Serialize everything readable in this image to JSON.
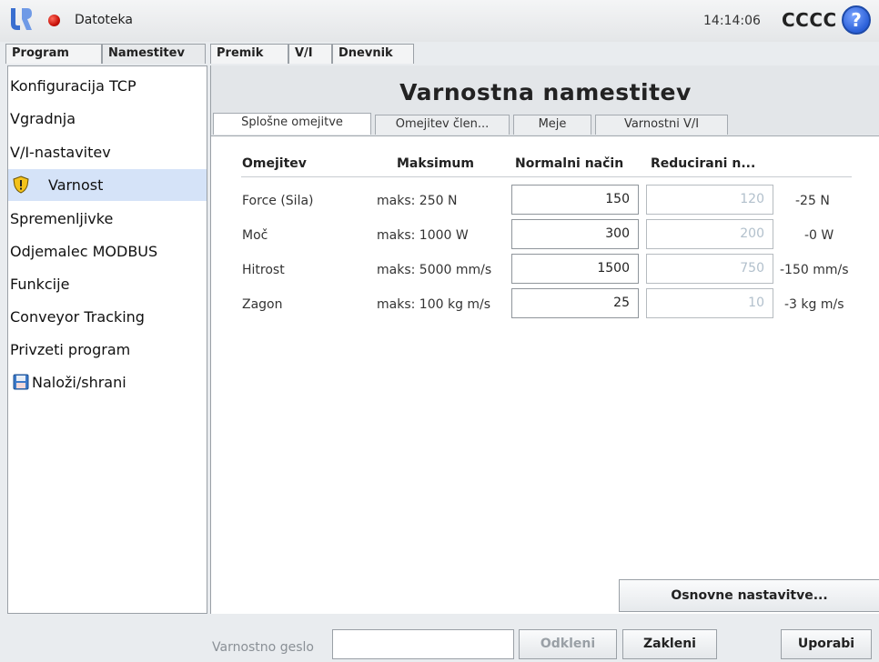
{
  "titlebar": {
    "file_label": "Datoteka",
    "time": "14:14:06",
    "robot_name": "CCCC",
    "help_glyph": "?",
    "status_color": "#d0150b"
  },
  "main_tabs": [
    "Program",
    "Namestitev",
    "Premik",
    "V/I",
    "Dnevnik"
  ],
  "active_main_tab": "Namestitev",
  "sidebar": {
    "items": [
      {
        "label": "Konfiguracija TCP"
      },
      {
        "label": "Vgradnja"
      },
      {
        "label": "V/I-nastavitev"
      },
      {
        "label": "Varnost",
        "icon": "warning-shield-icon",
        "active": true
      },
      {
        "label": "Spremenljivke"
      },
      {
        "label": "Odjemalec MODBUS"
      },
      {
        "label": "Funkcije"
      },
      {
        "label": "Conveyor Tracking"
      },
      {
        "label": "Privzeti program"
      },
      {
        "label": "Naloži/shrani",
        "icon": "floppy-disk-icon"
      }
    ]
  },
  "content": {
    "title": "Varnostna namestitev",
    "sub_tabs": [
      "Splošne omejitve",
      "Omejitev člen...",
      "Meje",
      "Varnostni V/I"
    ],
    "active_sub_tab": "Splošne omejitve",
    "table": {
      "headers": [
        "Omejitev",
        "Maksimum",
        "Normalni način",
        "Reducirani n..."
      ],
      "rows": [
        {
          "limit": "Force (Sila)",
          "max": "maks: 250 N",
          "normal": "150",
          "reduced": "120",
          "delta": "-25 N"
        },
        {
          "limit": "Moč",
          "max": "maks: 1000 W",
          "normal": "300",
          "reduced": "200",
          "delta": "-0 W"
        },
        {
          "limit": "Hitrost",
          "max": "maks: 5000 mm/s",
          "normal": "1500",
          "reduced": "750",
          "delta": "-150 mm/s"
        },
        {
          "limit": "Zagon",
          "max": "maks: 100 kg m/s",
          "normal": "25",
          "reduced": "10",
          "delta": "-3 kg m/s"
        }
      ]
    },
    "basic_settings_button": "Osnovne nastavitve..."
  },
  "bottom": {
    "password_label": "Varnostno geslo",
    "password_value": "",
    "unlock_button": "Odkleni",
    "lock_button": "Zakleni",
    "apply_button": "Uporabi"
  }
}
